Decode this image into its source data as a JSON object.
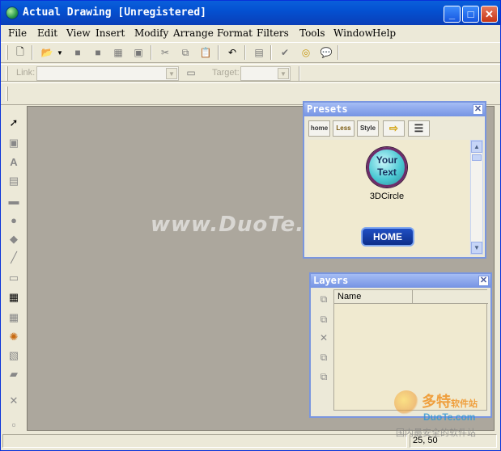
{
  "window": {
    "title": "Actual Drawing [Unregistered]"
  },
  "menu": [
    "File",
    "Edit",
    "View",
    "Insert",
    "Modify",
    "Arrange",
    "Format",
    "Filters",
    "Tools",
    "Window",
    "Help"
  ],
  "link_toolbar": {
    "link_label": "Link:",
    "link_value": "",
    "target_label": "Target:",
    "target_value": ""
  },
  "canvas": {
    "watermark": "www.DuoTe.com"
  },
  "presets": {
    "title": "Presets",
    "tabs": [
      "home-tab",
      "less-tab",
      "style-tab",
      "arrow-tab",
      "list-tab"
    ],
    "tab_labels": [
      "home",
      "Less",
      "Style"
    ],
    "item_text": "Your Text",
    "item_caption": "3DCircle",
    "home_button": "HOME"
  },
  "layers": {
    "title": "Layers",
    "columns": [
      "Name",
      ""
    ]
  },
  "status": {
    "coords": "25, 50"
  },
  "brand_watermark": {
    "name": "多特",
    "suffix": "软件站",
    "url": "DuoTe.com",
    "sub": "国内最安全的软件站"
  }
}
